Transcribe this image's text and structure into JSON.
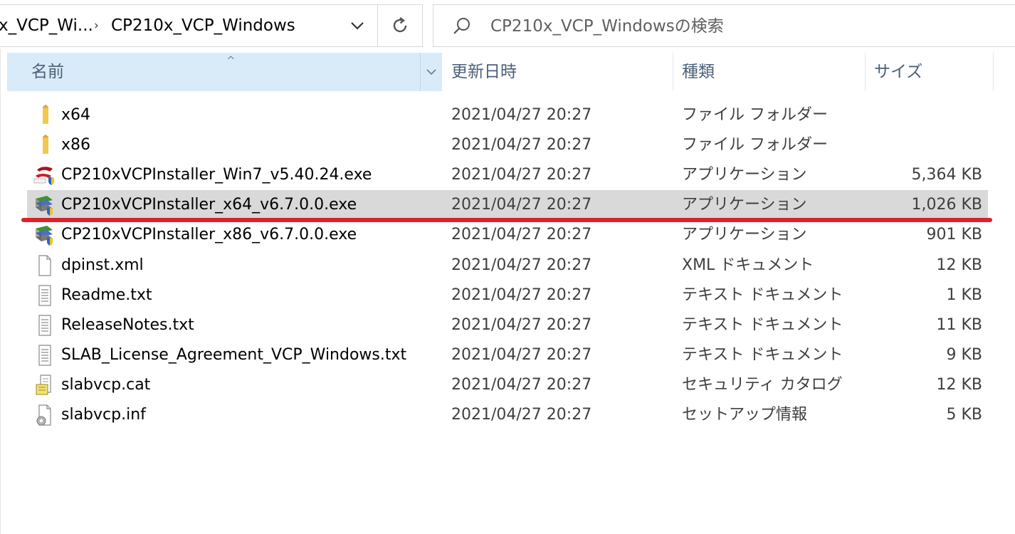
{
  "address_bar": {
    "crumb_parent": "x_VCP_Wi...",
    "crumb_separator": "›",
    "crumb_current": "CP210x_VCP_Windows"
  },
  "search": {
    "placeholder": "CP210x_VCP_Windowsの検索"
  },
  "columns": {
    "name": "名前",
    "date": "更新日時",
    "type": "種類",
    "size": "サイズ"
  },
  "files": [
    {
      "name": "x64",
      "date": "2021/04/27 20:27",
      "type": "ファイル フォルダー",
      "size": "",
      "icon": "folder-icon"
    },
    {
      "name": "x86",
      "date": "2021/04/27 20:27",
      "type": "ファイル フォルダー",
      "size": "",
      "icon": "folder-icon"
    },
    {
      "name": "CP210xVCPInstaller_Win7_v5.40.24.exe",
      "date": "2021/04/27 20:27",
      "type": "アプリケーション",
      "size": "5,364 KB",
      "icon": "silabs-installer-icon"
    },
    {
      "name": "CP210xVCPInstaller_x64_v6.7.0.0.exe",
      "date": "2021/04/27 20:27",
      "type": "アプリケーション",
      "size": "1,026 KB",
      "icon": "installer-icon"
    },
    {
      "name": "CP210xVCPInstaller_x86_v6.7.0.0.exe",
      "date": "2021/04/27 20:27",
      "type": "アプリケーション",
      "size": "901 KB",
      "icon": "installer-icon"
    },
    {
      "name": "dpinst.xml",
      "date": "2021/04/27 20:27",
      "type": "XML ドキュメント",
      "size": "12 KB",
      "icon": "blank-file-icon"
    },
    {
      "name": "Readme.txt",
      "date": "2021/04/27 20:27",
      "type": "テキスト ドキュメント",
      "size": "1 KB",
      "icon": "text-file-icon"
    },
    {
      "name": "ReleaseNotes.txt",
      "date": "2021/04/27 20:27",
      "type": "テキスト ドキュメント",
      "size": "11 KB",
      "icon": "text-file-icon"
    },
    {
      "name": "SLAB_License_Agreement_VCP_Windows.txt",
      "date": "2021/04/27 20:27",
      "type": "テキスト ドキュメント",
      "size": "9 KB",
      "icon": "text-file-icon"
    },
    {
      "name": "slabvcp.cat",
      "date": "2021/04/27 20:27",
      "type": "セキュリティ カタログ",
      "size": "12 KB",
      "icon": "catalog-file-icon"
    },
    {
      "name": "slabvcp.inf",
      "date": "2021/04/27 20:27",
      "type": "セットアップ情報",
      "size": "5 KB",
      "icon": "setup-info-file-icon"
    }
  ],
  "colors": {
    "selected_row": "#d9d9d9",
    "header_active": "#d9ebf9",
    "highlight_underline": "#e0202a"
  }
}
